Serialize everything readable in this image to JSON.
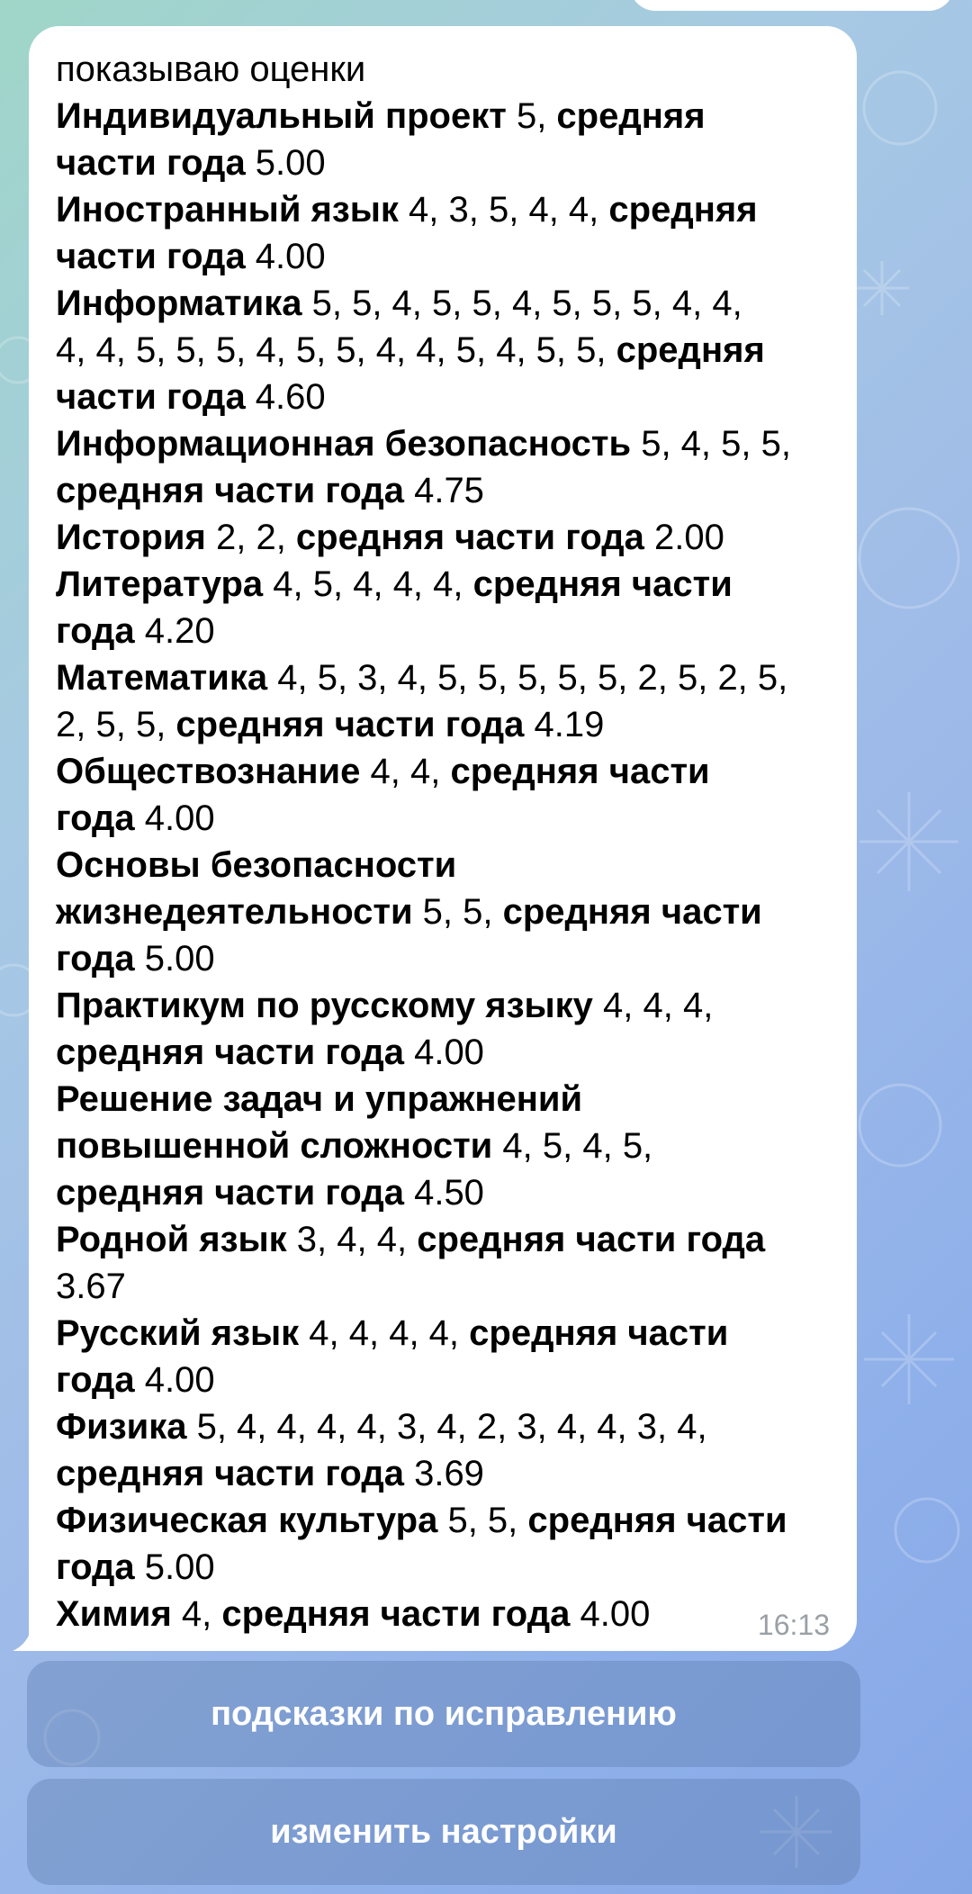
{
  "message": {
    "intro": "показываю оценки",
    "time": "16:13",
    "lines": [
      [
        {
          "t": "Индивидуальный проект",
          "b": true
        },
        {
          "t": " 5, ",
          "b": false
        },
        {
          "t": "средняя",
          "b": true
        }
      ],
      [
        {
          "t": "части года  ",
          "b": true
        },
        {
          "t": "5.00",
          "b": false
        }
      ],
      [
        {
          "t": "Иностранный язык",
          "b": true
        },
        {
          "t": " 4, 3, 5, 4, 4, ",
          "b": false
        },
        {
          "t": "средняя",
          "b": true
        }
      ],
      [
        {
          "t": "части года  ",
          "b": true
        },
        {
          "t": "4.00",
          "b": false
        }
      ],
      [
        {
          "t": "Информатика",
          "b": true
        },
        {
          "t": " 5, 5, 4, 5, 5, 4, 5, 5, 5, 4, 4,",
          "b": false
        }
      ],
      [
        {
          "t": "4, 4, 5, 5, 5, 4, 5, 5, 4, 4, 5, 4, 5, 5, ",
          "b": false
        },
        {
          "t": "средняя",
          "b": true
        }
      ],
      [
        {
          "t": "части года  ",
          "b": true
        },
        {
          "t": "4.60",
          "b": false
        }
      ],
      [
        {
          "t": "Информационная безопасность",
          "b": true
        },
        {
          "t": " 5, 4, 5, 5,",
          "b": false
        }
      ],
      [
        {
          "t": "средняя части года  ",
          "b": true
        },
        {
          "t": "4.75",
          "b": false
        }
      ],
      [
        {
          "t": "История",
          "b": true
        },
        {
          "t": " 2, 2, ",
          "b": false
        },
        {
          "t": "средняя части года  ",
          "b": true
        },
        {
          "t": "2.00",
          "b": false
        }
      ],
      [
        {
          "t": "Литература",
          "b": true
        },
        {
          "t": " 4, 5, 4, 4, 4, ",
          "b": false
        },
        {
          "t": "средняя части",
          "b": true
        }
      ],
      [
        {
          "t": "года  ",
          "b": true
        },
        {
          "t": "4.20",
          "b": false
        }
      ],
      [
        {
          "t": "Математика",
          "b": true
        },
        {
          "t": " 4, 5, 3, 4, 5, 5, 5, 5, 5, 2, 5, 2, 5,",
          "b": false
        }
      ],
      [
        {
          "t": "2, 5, 5, ",
          "b": false
        },
        {
          "t": "средняя части года  ",
          "b": true
        },
        {
          "t": "4.19",
          "b": false
        }
      ],
      [
        {
          "t": "Обществознание",
          "b": true
        },
        {
          "t": " 4, 4, ",
          "b": false
        },
        {
          "t": "средняя части",
          "b": true
        }
      ],
      [
        {
          "t": "года  ",
          "b": true
        },
        {
          "t": "4.00",
          "b": false
        }
      ],
      [
        {
          "t": "Основы безопасности",
          "b": true
        }
      ],
      [
        {
          "t": "жизнедеятельности",
          "b": true
        },
        {
          "t": " 5, 5, ",
          "b": false
        },
        {
          "t": "средняя части",
          "b": true
        }
      ],
      [
        {
          "t": "года  ",
          "b": true
        },
        {
          "t": "5.00",
          "b": false
        }
      ],
      [
        {
          "t": "Практикум по русскому языку",
          "b": true
        },
        {
          "t": " 4, 4, 4,",
          "b": false
        }
      ],
      [
        {
          "t": "средняя части года  ",
          "b": true
        },
        {
          "t": "4.00",
          "b": false
        }
      ],
      [
        {
          "t": "Решение задач и упражнений",
          "b": true
        }
      ],
      [
        {
          "t": "повышенной сложности",
          "b": true
        },
        {
          "t": " 4, 5, 4, 5,",
          "b": false
        }
      ],
      [
        {
          "t": "средняя части года  ",
          "b": true
        },
        {
          "t": "4.50",
          "b": false
        }
      ],
      [
        {
          "t": "Родной язык",
          "b": true
        },
        {
          "t": " 3, 4, 4, ",
          "b": false
        },
        {
          "t": "средняя части года",
          "b": true
        }
      ],
      [
        {
          "t": "3.67",
          "b": false
        }
      ],
      [
        {
          "t": "Русский язык",
          "b": true
        },
        {
          "t": " 4, 4, 4, 4, ",
          "b": false
        },
        {
          "t": "средняя части",
          "b": true
        }
      ],
      [
        {
          "t": "года  ",
          "b": true
        },
        {
          "t": "4.00",
          "b": false
        }
      ],
      [
        {
          "t": "Физика",
          "b": true
        },
        {
          "t": " 5, 4, 4, 4, 4, 3, 4, 2, 3, 4, 4, 3, 4,",
          "b": false
        }
      ],
      [
        {
          "t": "средняя части года  ",
          "b": true
        },
        {
          "t": "3.69",
          "b": false
        }
      ],
      [
        {
          "t": "Физическая культура",
          "b": true
        },
        {
          "t": " 5, 5, ",
          "b": false
        },
        {
          "t": "средняя части",
          "b": true
        }
      ],
      [
        {
          "t": "года  ",
          "b": true
        },
        {
          "t": "5.00",
          "b": false
        }
      ],
      [
        {
          "t": "Химия",
          "b": true
        },
        {
          "t": " 4, ",
          "b": false
        },
        {
          "t": "средняя части года  ",
          "b": true
        },
        {
          "t": "4.00",
          "b": false
        }
      ]
    ]
  },
  "keyboard": {
    "button1": "подсказки по исправлению",
    "button2": "изменить настройки"
  },
  "colors": {
    "bubble": "#ffffff",
    "button_bg": "#5a78aa",
    "time_text": "#9aa0a6"
  }
}
